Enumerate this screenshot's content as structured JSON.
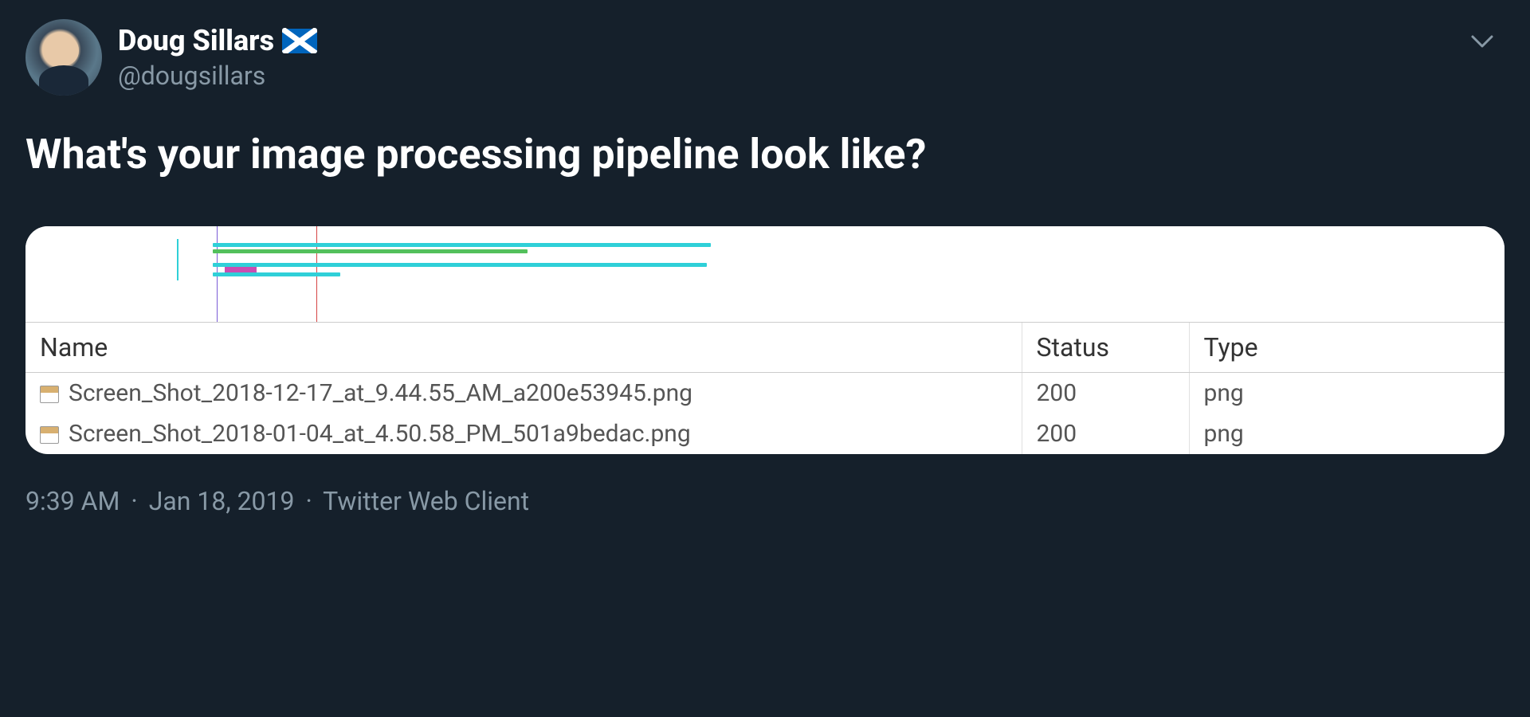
{
  "header": {
    "display_name": "Doug Sillars",
    "handle": "@dougsillars"
  },
  "tweet_text": "What's your image processing pipeline look like?",
  "network_panel": {
    "columns": {
      "name": "Name",
      "status": "Status",
      "type": "Type"
    },
    "rows": [
      {
        "name": "Screen_Shot_2018-12-17_at_9.44.55_AM_a200e53945.png",
        "status": "200",
        "type": "png"
      },
      {
        "name": "Screen_Shot_2018-01-04_at_4.50.58_PM_501a9bedac.png",
        "status": "200",
        "type": "png"
      }
    ]
  },
  "footer": {
    "time": "9:39 AM",
    "date": "Jan 18, 2019",
    "source": "Twitter Web Client",
    "sep": "·"
  },
  "colors": {
    "bar_cyan": "#2fd0d8",
    "bar_green": "#53c05c",
    "bar_magenta": "#c94eb1",
    "vline_purple": "#7a5cd6",
    "vline_red": "#d64545"
  }
}
